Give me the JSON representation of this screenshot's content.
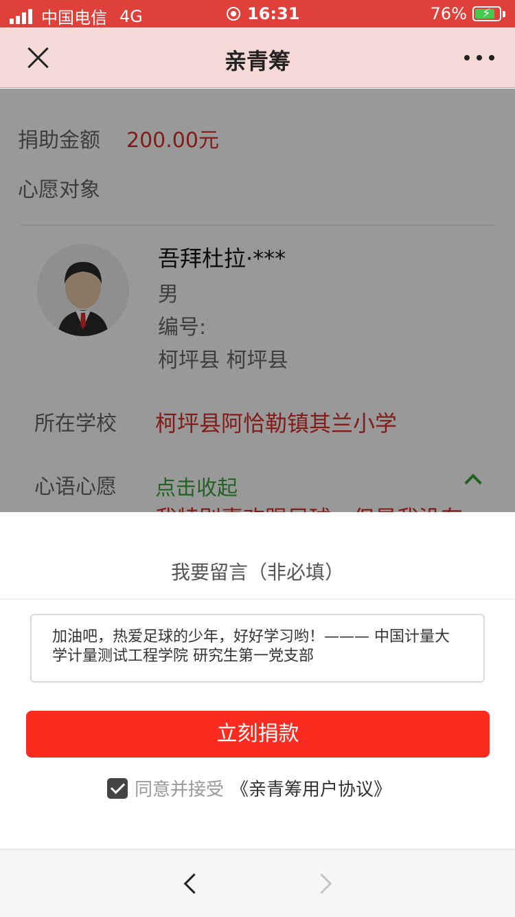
{
  "status_bar": {
    "carrier": "中国电信",
    "network": "4G",
    "time": "16:31",
    "battery": "76%"
  },
  "nav": {
    "title": "亲青筹"
  },
  "donation": {
    "amount_label": "捐助金额",
    "amount_value": "200.00元",
    "wish_target_label": "心愿对象"
  },
  "recipient": {
    "name": "吾拜杜拉·***",
    "gender": "男",
    "id_label": "编号:",
    "location": "柯坪县 柯坪县",
    "school_label": "所在学校",
    "school": "柯坪县阿恰勒镇其兰小学",
    "wish_label": "心语心愿",
    "collapse_link": "点击收起",
    "wish_text_partial": "我特别喜欢踢足球，但是我没有"
  },
  "sheet": {
    "title": "我要留言（非必填）",
    "message": "加油吧，热爱足球的少年，好好学习哟！——— 中国计量大学计量测试工程学院 研究生第一党支部",
    "donate_button": "立刻捐款",
    "agree_text": "同意并接受",
    "agreement_link": "《亲青筹用户协议》",
    "agree_checked": true
  },
  "colors": {
    "status_bar": "#e0403a",
    "nav_bar": "#f4d9d6",
    "accent_red": "#fb2b1f",
    "link_green": "#3aa33a"
  }
}
